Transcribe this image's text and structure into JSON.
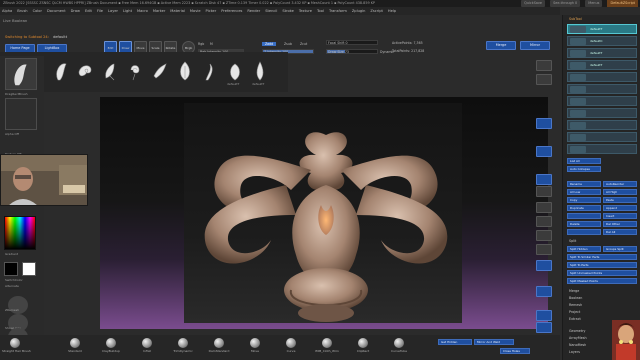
{
  "title": {
    "text": "ZBrush 2022 [SSSSC ZSNSC QLCM HWBS HPPRI] ZBrush Document  ▪ Free Mem 16.694GB ▪ Active Mem 2223 ▪ Scratch Disk 47 ▪ ZTime 0.139 Timer 0.022 ▪ PolyCount 3.432 KP ▪ MeshCount 1 ▪ PolyCount 438.859 KP",
    "quick_save": "QuickSave",
    "see_through": "See-through 0",
    "menus_label": "Menus",
    "default_zscript": "DefaultZScript"
  },
  "menubar": [
    "Alpha",
    "Brush",
    "Color",
    "Document",
    "Draw",
    "Edit",
    "File",
    "Layer",
    "Light",
    "Macro",
    "Marker",
    "Material",
    "Movie",
    "Picker",
    "Preferences",
    "Render",
    "Stencil",
    "Stroke",
    "Texture",
    "Tool",
    "Transform",
    "Zplugin",
    "Zscript",
    "Help"
  ],
  "lightbox": {
    "label": "Live Boolean",
    "home_page": "Home Page",
    "lightbox": "LightBox"
  },
  "subtool_hint": {
    "text": "Switching to Subtool 24:",
    "name": "defaultt"
  },
  "brush_shelf": [
    {
      "label": "",
      "icon": "feather-brush-icon"
    },
    {
      "label": "",
      "icon": "curl-brush-icon"
    },
    {
      "label": "",
      "icon": "leaf-brush-icon"
    },
    {
      "label": "",
      "icon": "swirl-brush-icon"
    },
    {
      "label": "",
      "icon": "scroll-brush-icon"
    },
    {
      "label": "",
      "icon": "acanthus-brush-icon"
    },
    {
      "label": "",
      "icon": "tendril-brush-icon"
    },
    {
      "label": "defaultT",
      "icon": "shell-brush-icon"
    },
    {
      "label": "defaultT",
      "icon": "drop-brush-icon"
    }
  ],
  "controls": {
    "edit": "Edit",
    "draw": "Draw",
    "move": "Move",
    "scale": "Scale",
    "rotate": "Rotate",
    "mrgb": "Mrgb",
    "rgb": "Rgb",
    "m": "M",
    "zadd": "Zadd",
    "zsub": "Zsub",
    "zcut": "Zcut",
    "focal_shift": "Focal Shift 0",
    "draw_size": "Draw Size 73",
    "dynamic": "Dynamic",
    "rgb_intensity": "Rgb Intensity 100",
    "z_intensity": "Z Intensity 100",
    "active_points": "ActivePoints: 7,365",
    "total_points": "TotalPoints: 217,828",
    "merge": "Merge",
    "mirror": "Mirror",
    "z_intensity_value": 100,
    "rgb_intensity_value": 100,
    "draw_size_value": 73
  },
  "leftpanel": {
    "brush_name": "DragRectBrush",
    "alpha_label": "Alpha Off",
    "texture_label": "Texture Off",
    "gradient_label": "Gradient",
    "switch_color": "SwitchColor",
    "alternate": "Alternate"
  },
  "bottombar": [
    {
      "label": "Straight Hair Brush"
    },
    {
      "label": "Standard"
    },
    {
      "label": "ClayBuildup"
    },
    {
      "label": "Inflat"
    },
    {
      "label": "TrimDynamic"
    },
    {
      "label": "DamStandard"
    },
    {
      "label": "Move"
    },
    {
      "label": "Curve"
    },
    {
      "label": "IMM_Cloth_Wrin"
    },
    {
      "label": "ClipRect"
    },
    {
      "label": "CurveTube"
    }
  ],
  "bottom_left_stack": [
    "ZRemesh",
    "ShowLines",
    "Edit Curve"
  ],
  "bottom_right_buttons": [
    "Get Hidden",
    "Mirror And Weld",
    "Close Holes"
  ],
  "rightpanel": {
    "header": "SubTool",
    "subtools": [
      "defaultT",
      "defaultC",
      "defaultT",
      "defaultT"
    ],
    "list_all": "List All",
    "auto_collapse": "Auto Collapse",
    "buttons": [
      [
        "Rename",
        "AutoReorder"
      ],
      [
        "All Low",
        "All High"
      ],
      [
        "Copy",
        "Paste"
      ],
      [
        "Duplicate",
        "Append"
      ],
      [
        "",
        "Insert"
      ],
      [
        "Delete",
        "Del Other"
      ],
      [
        "",
        "Del All"
      ]
    ],
    "split_header": "Split",
    "split_buttons": [
      "Split Hidden",
      "Groups Split",
      "Split To Similar Parts",
      "Split To Parts",
      "Split Unmasked Points",
      "Split Masked Points"
    ],
    "merge_items": [
      "Merge",
      "Boolean",
      "Remesh",
      "Project",
      "Extract"
    ],
    "lower_menus": [
      "Geometry",
      "ArrayMesh",
      "NanoMesh",
      "Layers"
    ]
  }
}
